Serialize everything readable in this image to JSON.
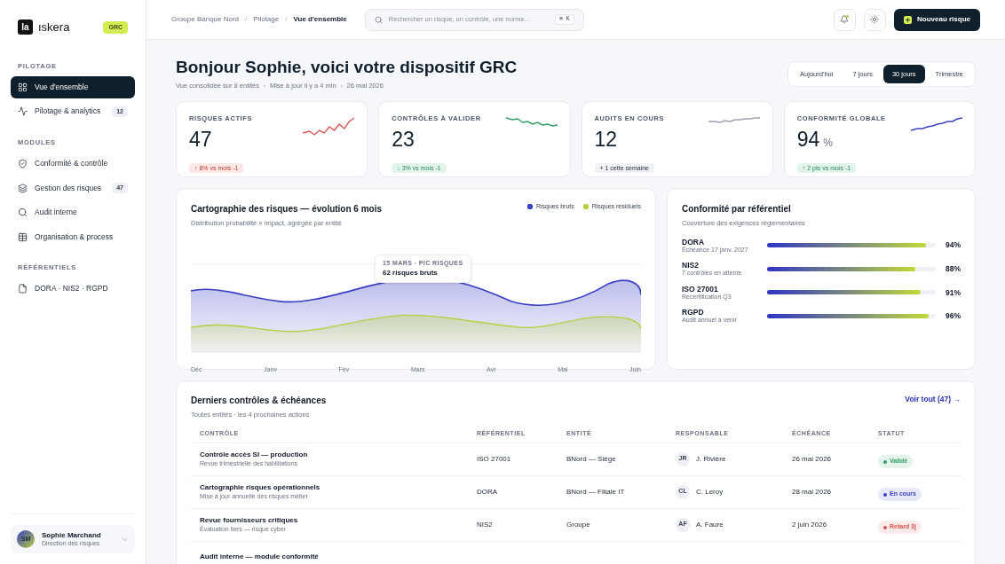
{
  "brand": {
    "name": "ıskera",
    "logo_text": "Ia",
    "badge": "GRC"
  },
  "sidebar": {
    "sections": [
      {
        "title": "PILOTAGE",
        "items": [
          {
            "label": "Vue d'ensemble",
            "selected": true
          },
          {
            "label": "Pilotage & analytics",
            "count": "12",
            "selected": false
          }
        ]
      },
      {
        "title": "MODULES",
        "items": [
          {
            "label": "Conformité & contrôle",
            "selected": false
          },
          {
            "label": "Gestion des risques",
            "count": "47",
            "selected": false
          },
          {
            "label": "Audit interne",
            "selected": false
          },
          {
            "label": "Organisation & process",
            "selected": false
          }
        ]
      },
      {
        "title": "RÉFÉRENTIELS",
        "items": [
          {
            "label": "DORA · NIS2 · RGPD",
            "selected": false
          }
        ]
      }
    ],
    "user": {
      "initials": "SM",
      "name": "Sophie Marchand",
      "role": "Direction des risques"
    }
  },
  "breadcrumb": [
    "Groupe Banque Nord",
    "Pilotage",
    "Vue d'ensemble"
  ],
  "breadcrumb_separator": "/",
  "search": {
    "placeholder": "Rechercher un risque, un contrôle, une norme...",
    "shortcut": "⌘ K"
  },
  "notifications": {
    "unread": true
  },
  "primary_button": "Nouveau risque",
  "heading": "Bonjour Sophie, voici votre dispositif GRC",
  "subheading": [
    "Vue consolidée sur 8 entités",
    "Mise à jour il y a 4 min",
    "26 mai 2026"
  ],
  "periods": [
    {
      "label": "Aujourd'hui",
      "selected": false
    },
    {
      "label": "7 jours",
      "selected": false
    },
    {
      "label": "30 jours",
      "selected": true
    },
    {
      "label": "Trimestre",
      "selected": false
    }
  ],
  "kpis": [
    {
      "label": "RISQUES ACTIFS",
      "value": "47",
      "delta": "↑ 8% vs mois -1",
      "kind": "bad",
      "color": "#d9534f"
    },
    {
      "label": "CONTRÔLES À VALIDER",
      "value": "23",
      "delta": "↓ 3% vs mois -1",
      "kind": "good",
      "color": "#2e9e64"
    },
    {
      "label": "AUDITS EN COURS",
      "value": "12",
      "delta": "+ 1 cette semaine",
      "kind": "neutral",
      "color": "#9ca3af"
    },
    {
      "label": "CONFORMITÉ GLOBALE",
      "value": "94",
      "unit": "%",
      "delta": "↑ 2 pts vs mois -1",
      "kind": "good",
      "color": "#3b3fc4"
    }
  ],
  "risk_chart": {
    "title": "Cartographie des risques — évolution 6 mois",
    "subtitle": "Distribution probabilité × impact, agrégée par entité",
    "legend": [
      {
        "label": "Risques bruts",
        "color": "#3b3fc4"
      },
      {
        "label": "Risques résiduels",
        "color": "#b5cf3f"
      }
    ],
    "tooltip": {
      "caption": "15 MARS · PIC RISQUES",
      "value": "62 risques bruts"
    },
    "months": [
      "Déc",
      "Janv",
      "Fév",
      "Mars",
      "Avr",
      "Mai",
      "Juin"
    ]
  },
  "compliance": {
    "title": "Conformité par référentiel",
    "subtitle": "Couverture des exigences réglementaires",
    "items": [
      {
        "name": "DORA",
        "note": "Échéance 17 janv. 2027",
        "level": 0.94,
        "reading": "94%"
      },
      {
        "name": "NIS2",
        "note": "7 contrôles en attente",
        "level": 0.88,
        "reading": "88%"
      },
      {
        "name": "ISO 27001",
        "note": "Recertification Q3",
        "level": 0.91,
        "reading": "91%"
      },
      {
        "name": "RGPD",
        "note": "Audit annuel à venir",
        "level": 0.96,
        "reading": "96%"
      }
    ]
  },
  "controls": {
    "title": "Derniers contrôles & échéances",
    "subtitle": "Toutes entités · les 4 prochaines actions",
    "link": "Voir tout (47) →",
    "columns": [
      "CONTRÔLE",
      "RÉFÉRENTIEL",
      "ENTITÉ",
      "RESPONSABLE",
      "ÉCHÉANCE",
      "STATUT"
    ],
    "rows": [
      {
        "title": "Contrôle accès SI — production",
        "detail": "Revue trimestrielle des habilitations",
        "framework": "ISO 27001",
        "entity": "BNord — Siège",
        "initials": "JR",
        "owner": "J. Rivière",
        "due": "26 mai 2026",
        "status": "Validé",
        "color": "#2e9e64"
      },
      {
        "title": "Cartographie risques opérationnels",
        "detail": "Mise à jour annuelle des risques métier",
        "framework": "DORA",
        "entity": "BNord — Filiale IT",
        "initials": "CL",
        "owner": "C. Leroy",
        "due": "28 mai 2026",
        "status": "En cours",
        "color": "#3b3fc4"
      },
      {
        "title": "Revue fournisseurs critiques",
        "detail": "Évaluation tiers — risque cyber",
        "framework": "NIS2",
        "entity": "Groupe",
        "initials": "AF",
        "owner": "A. Faure",
        "due": "2 juin 2026",
        "status": "Retard 3j",
        "color": "#d9534f"
      },
      {
        "title": "Audit interne — module conformité"
      }
    ]
  }
}
